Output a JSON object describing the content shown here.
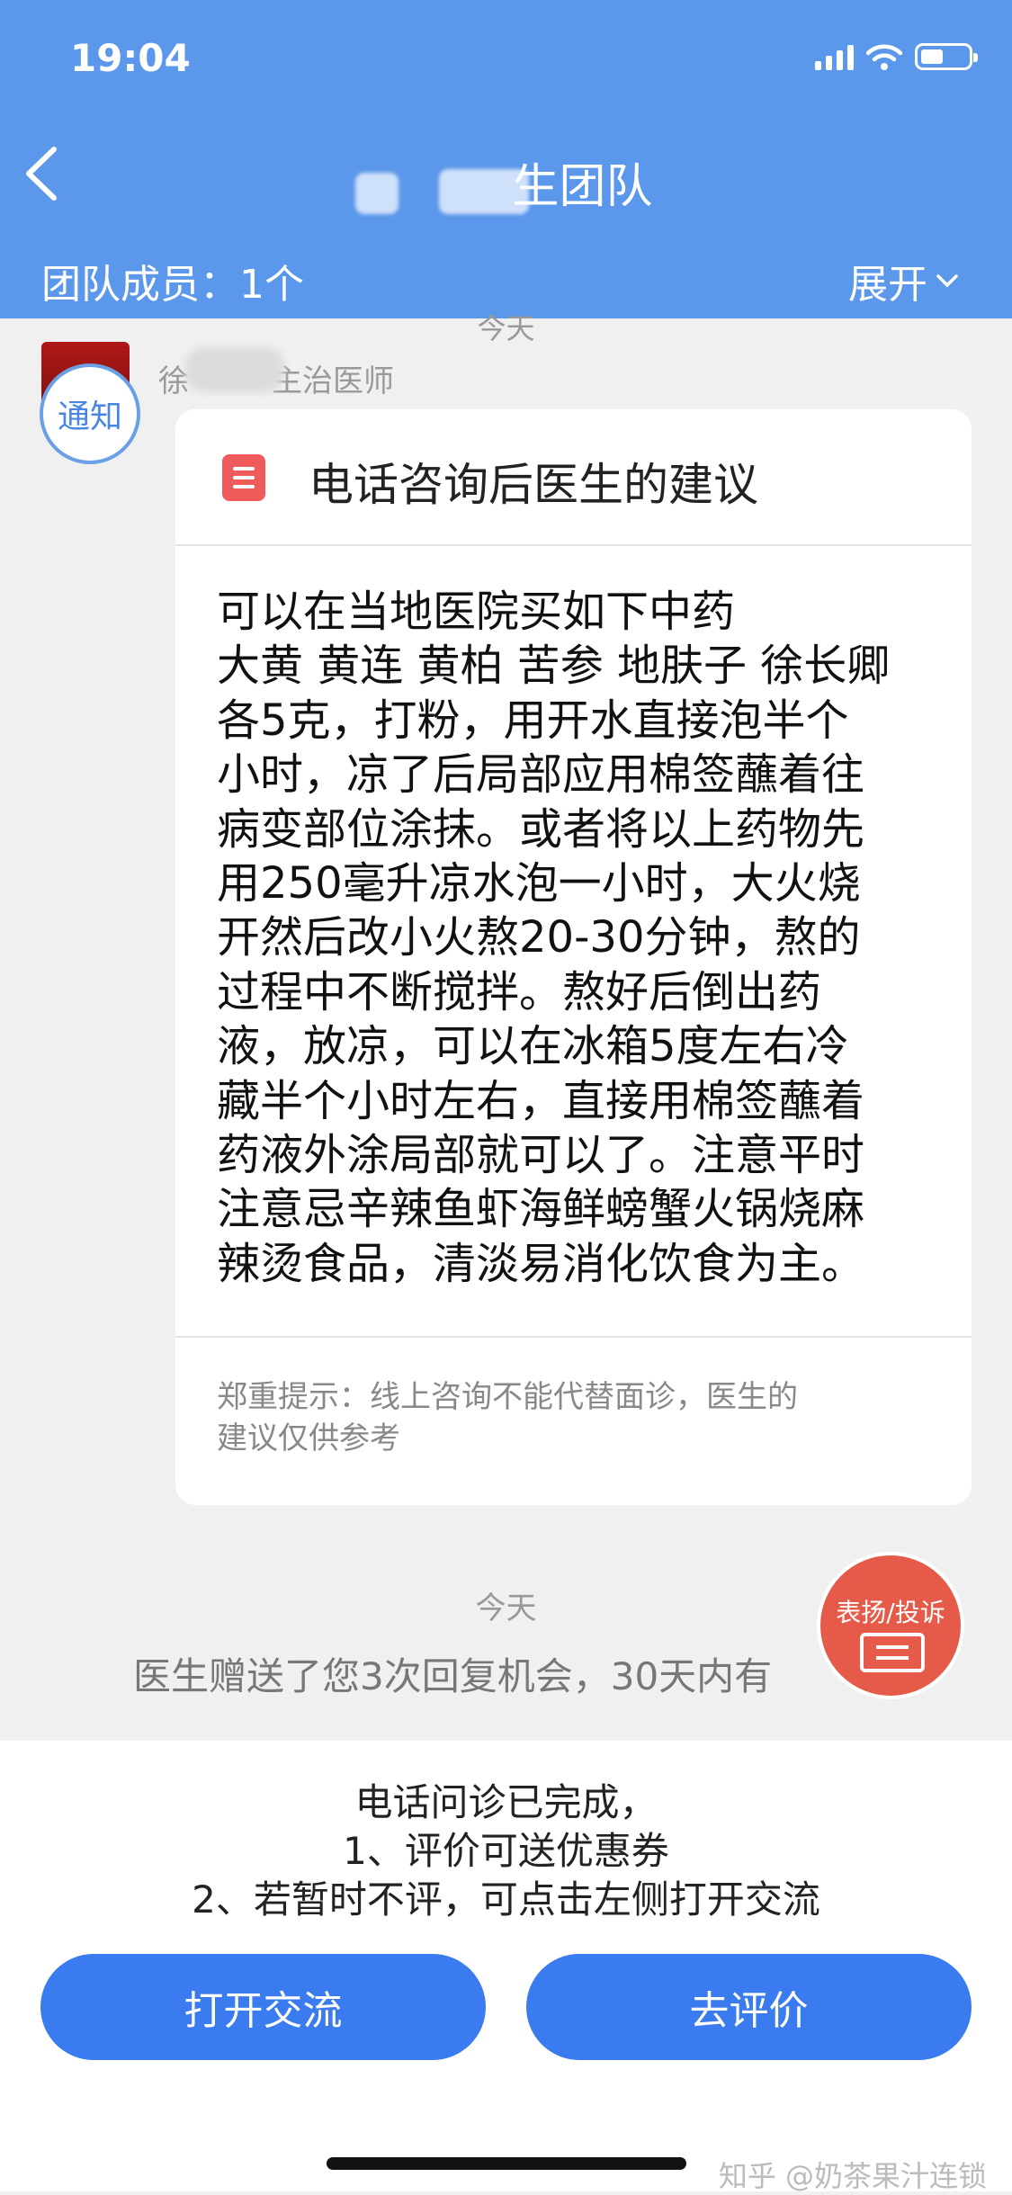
{
  "status_bar": {
    "time": "19:04"
  },
  "header": {
    "title": "生团队",
    "team_count": "团队成员：1个",
    "expand_label": "展开"
  },
  "chat": {
    "date_top": "今天",
    "sender": "徐",
    "sender_title": "主治医师",
    "notice_badge": "通知",
    "card": {
      "title": "电话咨询后医生的建议",
      "body": "可以在当地医院买如下中药\n大黄 黄连 黄柏 苦参 地肤子 徐长卿\n各5克，打粉，用开水直接泡半个\n小时，凉了后局部应用棉签蘸着往\n病变部位涂抹。或者将以上药物先\n用250毫升凉水泡一小时，大火烧\n开然后改小火熬20-30分钟，熬的\n过程中不断搅拌。熬好后倒出药\n液，放凉，可以在冰箱5度左右冷\n藏半个小时左右，直接用棉签蘸着\n药液外涂局部就可以了。注意平时\n注意忌辛辣鱼虾海鲜螃蟹火锅烧麻\n辣烫食品，清淡易消化饮食为主。",
      "note": "郑重提示：线上咨询不能代替面诊，医生的\n建议仅供参考"
    },
    "date_mid": "今天",
    "gift_message": "医生赠送了您3次回复机会，30天内有",
    "praise_button": "表扬/投诉"
  },
  "bottom": {
    "message_lines": [
      "电话问诊已完成，",
      "1、评价可送优惠券",
      "2、若暂时不评，可点击左侧打开交流"
    ],
    "open_button": "打开交流",
    "rate_button": "去评价"
  },
  "watermark": "知乎 @奶茶果汁连锁",
  "colors": {
    "header_bg": "#5b97ea",
    "button_bg": "#3a7bef",
    "praise_bg": "#e55a48",
    "doc_icon": "#ef5a5a"
  },
  "icons": [
    "back-arrow-icon",
    "signal-icon",
    "wifi-icon",
    "battery-icon",
    "chevron-down-icon",
    "document-icon",
    "praise-icon"
  ]
}
